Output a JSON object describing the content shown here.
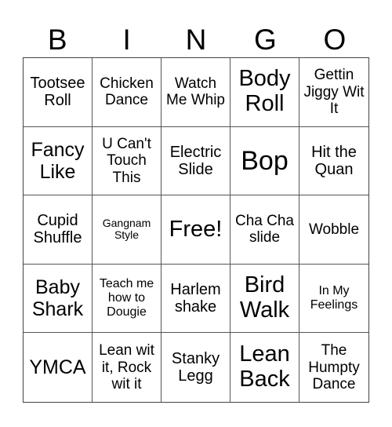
{
  "card": {
    "header_letters": [
      "B",
      "I",
      "N",
      "G",
      "O"
    ],
    "rows": [
      [
        "Tootsee Roll",
        "Chicken Dance",
        "Watch Me Whip",
        "Body Roll",
        "Gettin Jiggy Wit It"
      ],
      [
        "Fancy Like",
        "U Can't Touch This",
        "Electric Slide",
        "Bop",
        "Hit the Quan"
      ],
      [
        "Cupid Shuffle",
        "Gangnam Style",
        "Free!",
        "Cha Cha slide",
        "Wobble"
      ],
      [
        "Baby Shark",
        "Teach me how to Dougie",
        "Harlem shake",
        "Bird Walk",
        "In My Feelings"
      ],
      [
        "YMCA",
        "Lean wit it, Rock wit it",
        "Stanky Legg",
        "Lean Back",
        "The Humpty Dance"
      ]
    ],
    "free_space": "Free!"
  }
}
